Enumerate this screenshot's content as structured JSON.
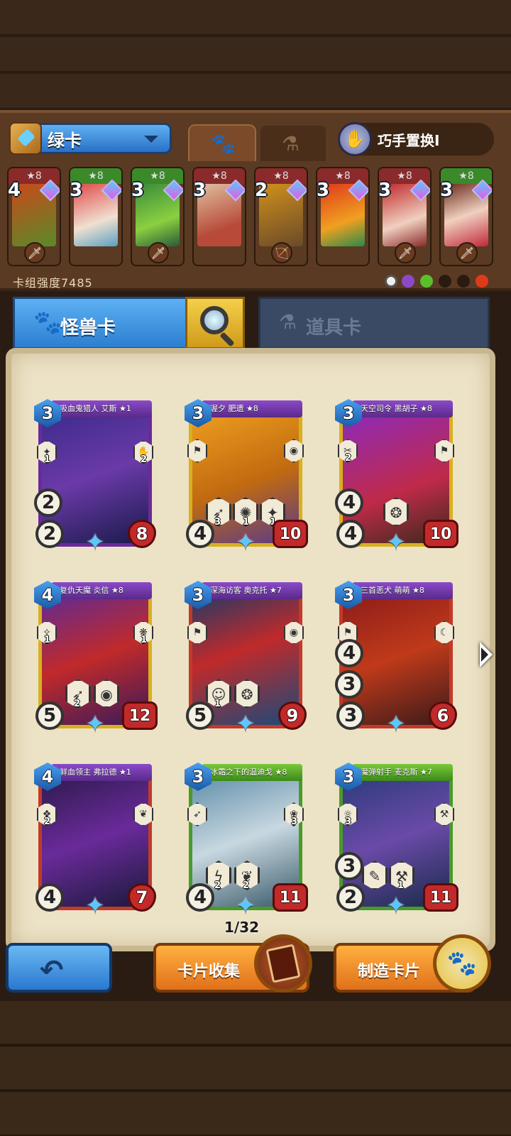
{
  "deck": {
    "name": "绿卡",
    "strength": "卡组强度7485",
    "swap_label": "巧手置换I",
    "mini_cards": [
      {
        "cost": "4",
        "stars": "★8",
        "color": "red"
      },
      {
        "cost": "3",
        "stars": "★8",
        "color": "green"
      },
      {
        "cost": "3",
        "stars": "★8",
        "color": "green"
      },
      {
        "cost": "3",
        "stars": "★8",
        "color": "red"
      },
      {
        "cost": "2",
        "stars": "★8",
        "color": "red"
      },
      {
        "cost": "3",
        "stars": "★8",
        "color": "red"
      },
      {
        "cost": "3",
        "stars": "★8",
        "color": "red"
      },
      {
        "cost": "3",
        "stars": "★8",
        "color": "green"
      }
    ]
  },
  "sections": {
    "monster_label": "怪兽卡",
    "items_label": "道具卡"
  },
  "cards": [
    {
      "title": "吸血鬼猎人 艾斯 ★1",
      "cost": "3",
      "atk": "2",
      "hp": "8",
      "extra": "2",
      "ab_left": "1",
      "ab_right": "2"
    },
    {
      "title": "渥夕 肥遗 ★8",
      "cost": "3",
      "atk": "4",
      "hp": "10",
      "mid": [
        "3",
        "1",
        "1"
      ]
    },
    {
      "title": "天空司令 黑胡子 ★8",
      "cost": "3",
      "atk": "4",
      "hp": "10",
      "extra": "4",
      "ab_left": "2"
    },
    {
      "title": "复仇天魔 炎信 ★8",
      "cost": "4",
      "atk": "5",
      "hp": "12",
      "ab_left": "1",
      "ab_right": "1",
      "mid": [
        "2"
      ]
    },
    {
      "title": "深海访客 奥克托 ★7",
      "cost": "3",
      "atk": "5",
      "hp": "9",
      "mid": [
        "1"
      ]
    },
    {
      "title": "三首恶犬 萌萌 ★8",
      "cost": "3",
      "atk": "3",
      "hp": "6",
      "extra": "4",
      "extra2": "3"
    },
    {
      "title": "鲜血领主 弗拉德 ★1",
      "cost": "4",
      "atk": "4",
      "hp": "7",
      "ab_left": "2"
    },
    {
      "title": "冰霜之下的温迪戈 ★8",
      "cost": "3",
      "atk": "4",
      "hp": "11",
      "ab_right": "3",
      "mid": [
        "2",
        "2"
      ]
    },
    {
      "title": "魔弹射手 麦克斯 ★7",
      "cost": "3",
      "atk": "2",
      "hp": "11",
      "extra": "3",
      "ab_left": "3",
      "mid": [
        "1"
      ]
    }
  ],
  "pager": "1/32",
  "buttons": {
    "collect": "卡片收集",
    "make": "制造卡片"
  }
}
